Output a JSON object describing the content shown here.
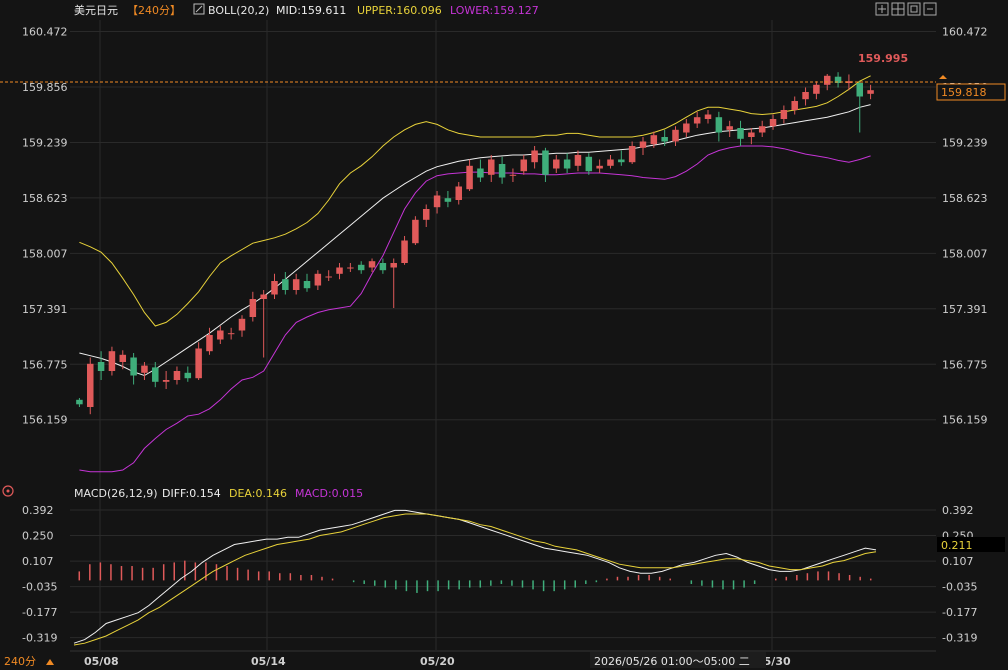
{
  "header": {
    "symbol": "美元日元",
    "period_tag": "【240分】",
    "boll_label": "BOLL(20,2)",
    "mid": "MID:159.611",
    "upper": "UPPER:160.096",
    "lower": "LOWER:159.127"
  },
  "macd_header": {
    "label": "MACD(26,12,9)",
    "diff": "DIFF:0.154",
    "dea": "DEA:0.146",
    "macd": "MACD:0.015"
  },
  "footer": {
    "period": "240分",
    "tooltip": "2026/05/26 01:00～05:00 二"
  },
  "price_current": "159.818",
  "price_high_label": "159.995",
  "macd_current": "0.211",
  "colors": {
    "background": "#141414",
    "grid": "#2a2a2a",
    "up": "#e05a5a",
    "down": "#3fae7b",
    "upper": "#e8d23a",
    "mid": "#f0f0f0",
    "lower": "#c534d6",
    "price_line": "#f08a24",
    "high_label": "#e05a5a",
    "label_text": "#cfcfcf"
  },
  "chart_data": [
    {
      "type": "candlestick",
      "title": "美元日元 240分",
      "y_ticks": [
        "160.472",
        "159.856",
        "159.239",
        "158.623",
        "158.007",
        "157.391",
        "156.775",
        "156.159"
      ],
      "x_ticks": [
        "05/08",
        "05/14",
        "05/20",
        "05/30"
      ],
      "ylim": [
        155.6,
        160.6
      ],
      "series": [
        {
          "name": "UPPER",
          "values": [
            158.13,
            158.08,
            158.02,
            157.9,
            157.73,
            157.55,
            157.35,
            157.2,
            157.24,
            157.33,
            157.45,
            157.58,
            157.75,
            157.9,
            157.98,
            158.05,
            158.12,
            158.15,
            158.18,
            158.22,
            158.28,
            158.35,
            158.45,
            158.6,
            158.78,
            158.9,
            158.98,
            159.08,
            159.2,
            159.3,
            159.38,
            159.44,
            159.47,
            159.44,
            159.38,
            159.34,
            159.32,
            159.3,
            159.3,
            159.3,
            159.3,
            159.3,
            159.3,
            159.32,
            159.32,
            159.34,
            159.34,
            159.32,
            159.3,
            159.3,
            159.3,
            159.3,
            159.32,
            159.35,
            159.39,
            159.45,
            159.52,
            159.59,
            159.63,
            159.63,
            159.61,
            159.59,
            159.56,
            159.55,
            159.56,
            159.58,
            159.6,
            159.62,
            159.64,
            159.68,
            159.75,
            159.83,
            159.92,
            159.98
          ]
        },
        {
          "name": "MID",
          "values": [
            156.9,
            156.87,
            156.84,
            156.8,
            156.75,
            156.69,
            156.65,
            156.72,
            156.8,
            156.88,
            156.96,
            157.04,
            157.12,
            157.21,
            157.3,
            157.38,
            157.45,
            157.53,
            157.62,
            157.72,
            157.82,
            157.92,
            158.02,
            158.12,
            158.22,
            158.32,
            158.42,
            158.52,
            158.62,
            158.7,
            158.78,
            158.85,
            158.92,
            158.97,
            159.0,
            159.03,
            159.05,
            159.07,
            159.08,
            159.09,
            159.1,
            159.1,
            159.11,
            159.11,
            159.12,
            159.12,
            159.13,
            159.13,
            159.14,
            159.15,
            159.16,
            159.17,
            159.19,
            159.21,
            159.23,
            159.26,
            159.29,
            159.32,
            159.34,
            159.36,
            159.37,
            159.38,
            159.39,
            159.4,
            159.42,
            159.44,
            159.46,
            159.48,
            159.5,
            159.52,
            159.55,
            159.58,
            159.63,
            159.66
          ]
        },
        {
          "name": "LOWER",
          "values": [
            155.6,
            155.58,
            155.58,
            155.58,
            155.6,
            155.68,
            155.84,
            155.95,
            156.05,
            156.12,
            156.2,
            156.22,
            156.28,
            156.38,
            156.5,
            156.6,
            156.63,
            156.7,
            156.9,
            157.1,
            157.24,
            157.3,
            157.35,
            157.38,
            157.4,
            157.42,
            157.56,
            157.78,
            157.98,
            158.24,
            158.5,
            158.68,
            158.81,
            158.87,
            158.89,
            158.9,
            158.91,
            158.91,
            158.9,
            158.9,
            158.9,
            158.89,
            158.89,
            158.88,
            158.88,
            158.89,
            158.9,
            158.9,
            158.9,
            158.89,
            158.88,
            158.87,
            158.85,
            158.84,
            158.83,
            158.86,
            158.92,
            159.0,
            159.1,
            159.15,
            159.18,
            159.2,
            159.2,
            159.2,
            159.19,
            159.17,
            159.14,
            159.11,
            159.09,
            159.07,
            159.04,
            159.02,
            159.05,
            159.09
          ]
        }
      ],
      "candles": [
        [
          156.38,
          156.33,
          156.4,
          156.3
        ],
        [
          156.3,
          156.78,
          156.85,
          156.22
        ],
        [
          156.8,
          156.7,
          156.92,
          156.6
        ],
        [
          156.7,
          156.92,
          156.97,
          156.65
        ],
        [
          156.8,
          156.88,
          156.93,
          156.72
        ],
        [
          156.85,
          156.65,
          156.9,
          156.55
        ],
        [
          156.68,
          156.76,
          156.8,
          156.6
        ],
        [
          156.74,
          156.58,
          156.8,
          156.52
        ],
        [
          156.58,
          156.6,
          156.7,
          156.5
        ],
        [
          156.6,
          156.7,
          156.75,
          156.55
        ],
        [
          156.68,
          156.62,
          156.75,
          156.58
        ],
        [
          156.62,
          156.95,
          157.02,
          156.6
        ],
        [
          156.92,
          157.1,
          157.18,
          156.88
        ],
        [
          157.05,
          157.15,
          157.2,
          157.0
        ],
        [
          157.12,
          157.12,
          157.18,
          157.05
        ],
        [
          157.15,
          157.28,
          157.32,
          157.08
        ],
        [
          157.3,
          157.5,
          157.58,
          157.25
        ],
        [
          157.5,
          157.55,
          157.6,
          156.85
        ],
        [
          157.55,
          157.7,
          157.78,
          157.5
        ],
        [
          157.72,
          157.6,
          157.8,
          157.55
        ],
        [
          157.6,
          157.72,
          157.78,
          157.55
        ],
        [
          157.7,
          157.62,
          157.78,
          157.58
        ],
        [
          157.65,
          157.78,
          157.82,
          157.6
        ],
        [
          157.75,
          157.75,
          157.82,
          157.7
        ],
        [
          157.78,
          157.85,
          157.9,
          157.72
        ],
        [
          157.85,
          157.85,
          157.9,
          157.8
        ],
        [
          157.88,
          157.82,
          157.92,
          157.78
        ],
        [
          157.85,
          157.92,
          157.95,
          157.8
        ],
        [
          157.9,
          157.82,
          157.95,
          157.78
        ],
        [
          157.85,
          157.9,
          157.95,
          157.4
        ],
        [
          157.9,
          158.15,
          158.2,
          157.88
        ],
        [
          158.12,
          158.38,
          158.42,
          158.1
        ],
        [
          158.38,
          158.5,
          158.55,
          158.3
        ],
        [
          158.52,
          158.65,
          158.7,
          158.45
        ],
        [
          158.62,
          158.58,
          158.7,
          158.52
        ],
        [
          158.6,
          158.75,
          158.8,
          158.55
        ],
        [
          158.72,
          158.98,
          159.05,
          158.7
        ],
        [
          158.95,
          158.85,
          159.05,
          158.8
        ],
        [
          158.88,
          159.05,
          159.1,
          158.8
        ],
        [
          159.0,
          158.85,
          159.08,
          158.78
        ],
        [
          158.88,
          158.88,
          158.95,
          158.8
        ],
        [
          158.92,
          159.05,
          159.1,
          158.88
        ],
        [
          159.02,
          159.15,
          159.2,
          158.95
        ],
        [
          159.15,
          158.88,
          159.18,
          158.8
        ],
        [
          158.95,
          159.05,
          159.1,
          158.9
        ],
        [
          159.05,
          158.95,
          159.12,
          158.9
        ],
        [
          158.98,
          159.1,
          159.15,
          158.92
        ],
        [
          159.08,
          158.92,
          159.12,
          158.88
        ],
        [
          158.95,
          158.98,
          159.05,
          158.9
        ],
        [
          158.98,
          159.05,
          159.1,
          158.95
        ],
        [
          159.05,
          159.02,
          159.15,
          158.98
        ],
        [
          159.02,
          159.2,
          159.25,
          159.0
        ],
        [
          159.18,
          159.25,
          159.3,
          159.1
        ],
        [
          159.22,
          159.32,
          159.36,
          159.18
        ],
        [
          159.3,
          159.25,
          159.38,
          159.2
        ],
        [
          159.25,
          159.38,
          159.42,
          159.2
        ],
        [
          159.35,
          159.45,
          159.5,
          159.3
        ],
        [
          159.45,
          159.52,
          159.58,
          159.4
        ],
        [
          159.5,
          159.55,
          159.6,
          159.45
        ],
        [
          159.52,
          159.35,
          159.58,
          159.25
        ],
        [
          159.38,
          159.42,
          159.48,
          159.3
        ],
        [
          159.4,
          159.28,
          159.48,
          159.2
        ],
        [
          159.3,
          159.35,
          159.4,
          159.22
        ],
        [
          159.35,
          159.42,
          159.48,
          159.3
        ],
        [
          159.42,
          159.5,
          159.55,
          159.38
        ],
        [
          159.5,
          159.6,
          159.65,
          159.45
        ],
        [
          159.6,
          159.7,
          159.75,
          159.55
        ],
        [
          159.72,
          159.8,
          159.85,
          159.65
        ],
        [
          159.78,
          159.88,
          159.92,
          159.72
        ],
        [
          159.88,
          159.98,
          160.0,
          159.82
        ],
        [
          159.97,
          159.9,
          160.02,
          159.85
        ],
        [
          159.9,
          159.92,
          159.995,
          159.82
        ],
        [
          159.9,
          159.75,
          159.92,
          159.35
        ],
        [
          159.78,
          159.82,
          159.88,
          159.72
        ]
      ]
    },
    {
      "type": "macd",
      "y_ticks": [
        "0.392",
        "0.250",
        "0.107",
        "-0.035",
        "-0.177",
        "-0.319"
      ],
      "ylim": [
        -0.36,
        0.42
      ],
      "series": [
        {
          "name": "DIFF",
          "values": [
            -0.35,
            -0.33,
            -0.29,
            -0.24,
            -0.22,
            -0.2,
            -0.18,
            -0.14,
            -0.09,
            -0.04,
            0.01,
            0.05,
            0.1,
            0.14,
            0.17,
            0.2,
            0.21,
            0.22,
            0.23,
            0.23,
            0.24,
            0.24,
            0.26,
            0.28,
            0.29,
            0.3,
            0.31,
            0.33,
            0.35,
            0.37,
            0.39,
            0.39,
            0.38,
            0.37,
            0.36,
            0.35,
            0.34,
            0.32,
            0.3,
            0.28,
            0.26,
            0.24,
            0.22,
            0.2,
            0.18,
            0.17,
            0.16,
            0.15,
            0.14,
            0.12,
            0.1,
            0.07,
            0.05,
            0.04,
            0.04,
            0.05,
            0.07,
            0.09,
            0.1,
            0.12,
            0.14,
            0.15,
            0.13,
            0.1,
            0.08,
            0.06,
            0.05,
            0.05,
            0.06,
            0.08,
            0.1,
            0.12,
            0.14,
            0.16,
            0.18,
            0.17
          ]
        },
        {
          "name": "DEA",
          "values": [
            -0.36,
            -0.35,
            -0.33,
            -0.31,
            -0.28,
            -0.25,
            -0.22,
            -0.18,
            -0.15,
            -0.11,
            -0.07,
            -0.03,
            0.01,
            0.05,
            0.08,
            0.11,
            0.14,
            0.16,
            0.18,
            0.2,
            0.21,
            0.22,
            0.23,
            0.25,
            0.26,
            0.27,
            0.29,
            0.31,
            0.33,
            0.35,
            0.36,
            0.37,
            0.37,
            0.37,
            0.36,
            0.35,
            0.34,
            0.33,
            0.31,
            0.3,
            0.28,
            0.26,
            0.24,
            0.22,
            0.21,
            0.19,
            0.18,
            0.17,
            0.15,
            0.13,
            0.11,
            0.09,
            0.08,
            0.07,
            0.07,
            0.07,
            0.07,
            0.08,
            0.09,
            0.1,
            0.11,
            0.12,
            0.12,
            0.11,
            0.1,
            0.08,
            0.07,
            0.06,
            0.06,
            0.07,
            0.08,
            0.1,
            0.11,
            0.13,
            0.15,
            0.16
          ]
        },
        {
          "name": "MACD",
          "values": [
            0.05,
            0.09,
            0.1,
            0.09,
            0.08,
            0.08,
            0.07,
            0.07,
            0.09,
            0.1,
            0.11,
            0.1,
            0.1,
            0.09,
            0.08,
            0.07,
            0.06,
            0.05,
            0.05,
            0.04,
            0.04,
            0.03,
            0.03,
            0.02,
            0.01,
            0.0,
            -0.01,
            -0.02,
            -0.03,
            -0.04,
            -0.05,
            -0.06,
            -0.07,
            -0.06,
            -0.06,
            -0.05,
            -0.05,
            -0.04,
            -0.04,
            -0.03,
            -0.02,
            -0.03,
            -0.04,
            -0.05,
            -0.06,
            -0.06,
            -0.05,
            -0.04,
            -0.02,
            -0.01,
            0.01,
            0.02,
            0.02,
            0.03,
            0.03,
            0.02,
            0.01,
            0.0,
            -0.02,
            -0.03,
            -0.04,
            -0.05,
            -0.05,
            -0.04,
            -0.02,
            0.0,
            0.01,
            0.02,
            0.03,
            0.04,
            0.05,
            0.05,
            0.04,
            0.03,
            0.02,
            0.01
          ]
        }
      ]
    }
  ]
}
